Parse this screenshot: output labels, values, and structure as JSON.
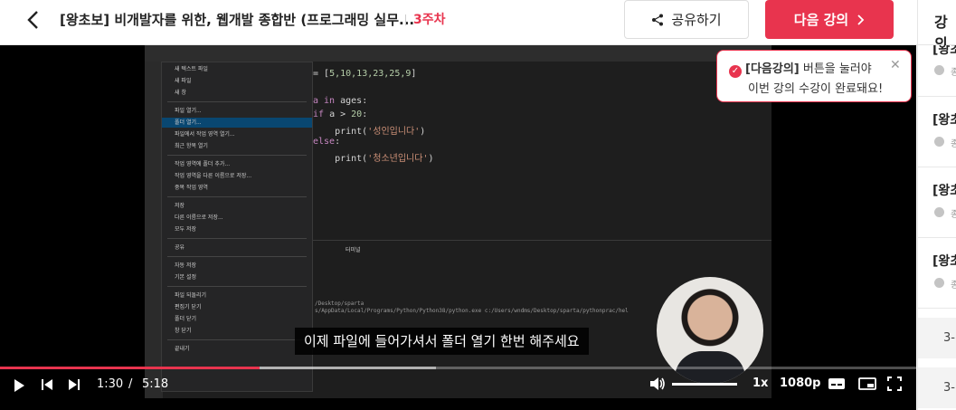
{
  "header": {
    "title": "[왕초보] 비개발자를 위한, 웹개발 종합반 (프로그래밍 실무...",
    "week": "3주차",
    "share_label": "공유하기",
    "next_label": "다음 강의",
    "right_panel_title": "강의"
  },
  "toast": {
    "highlight": "[다음강의]",
    "line1_rest": " 버튼을 눌러야",
    "line2": "이번 강의 수강이 완료돼요!"
  },
  "player": {
    "subtitle": "이제 파일에 들어가셔서 폴더 열기 한번 해주세요",
    "current_time": "1:30",
    "separator": "/",
    "duration": "5:18",
    "rate": "1x",
    "quality": "1080p",
    "progress": 0.283,
    "buffered": 0.476
  },
  "vscode": {
    "code_lines": [
      {
        "parts": [
          [
            "",
            "= "
          ],
          [
            "",
            "["
          ],
          [
            "num",
            "5,10,13,23,25,9"
          ],
          [
            "",
            "]"
          ]
        ]
      },
      {
        "parts": [
          [
            "",
            ""
          ]
        ]
      },
      {
        "parts": [
          [
            "kw",
            "a in"
          ],
          [
            "",
            " ages:"
          ]
        ]
      },
      {
        "parts": [
          [
            "kw",
            "if"
          ],
          [
            "",
            " a > "
          ],
          [
            "num",
            "20"
          ],
          [
            "",
            ":"
          ]
        ]
      },
      {
        "parts": [
          [
            "",
            "    print("
          ],
          [
            "str",
            "'성인입니다'"
          ],
          [
            "",
            ")"
          ]
        ]
      },
      {
        "parts": [
          [
            "kw",
            "else"
          ],
          [
            "",
            ":"
          ]
        ]
      },
      {
        "parts": [
          [
            "",
            "    print("
          ],
          [
            "str",
            "'청소년입니다'"
          ],
          [
            "",
            ")"
          ]
        ]
      }
    ],
    "menu_items": [
      "새 텍스트 파일",
      "새 파일",
      "새 창",
      "",
      "파일 열기...",
      "폴더 열기...",
      "파일에서 작업 영역 열기...",
      "최근 항목 열기",
      "",
      "작업 영역에 폴더 추가...",
      "작업 영역을 다른 이름으로 저장...",
      "중복 작업 영역",
      "",
      "저장",
      "다른 이름으로 저장...",
      "모두 저장",
      "",
      "공유",
      "",
      "자동 저장",
      "기본 설정",
      "",
      "파일 되돌리기",
      "편집기 닫기",
      "폴더 닫기",
      "창 닫기",
      "",
      "끝내기"
    ],
    "terminal_tab": "터미널",
    "terminal_lines": [
      "/Desktop/sparta",
      "s/AppData/Local/Programs/Python/Python38/python.exe c:/Users/wndms/Desktop/sparta/pythonprac/hel"
    ]
  },
  "chapters": [
    {
      "title": "[왕초",
      "sub": "종"
    },
    {
      "title": "[왕초",
      "sub": "종"
    },
    {
      "title": "[왕초",
      "sub": "종"
    },
    {
      "title": "[왕초",
      "sub": "종"
    }
  ],
  "lessons": [
    {
      "label": "3-"
    },
    {
      "label": "3-"
    }
  ],
  "colors": {
    "accent": "#e8344e"
  }
}
